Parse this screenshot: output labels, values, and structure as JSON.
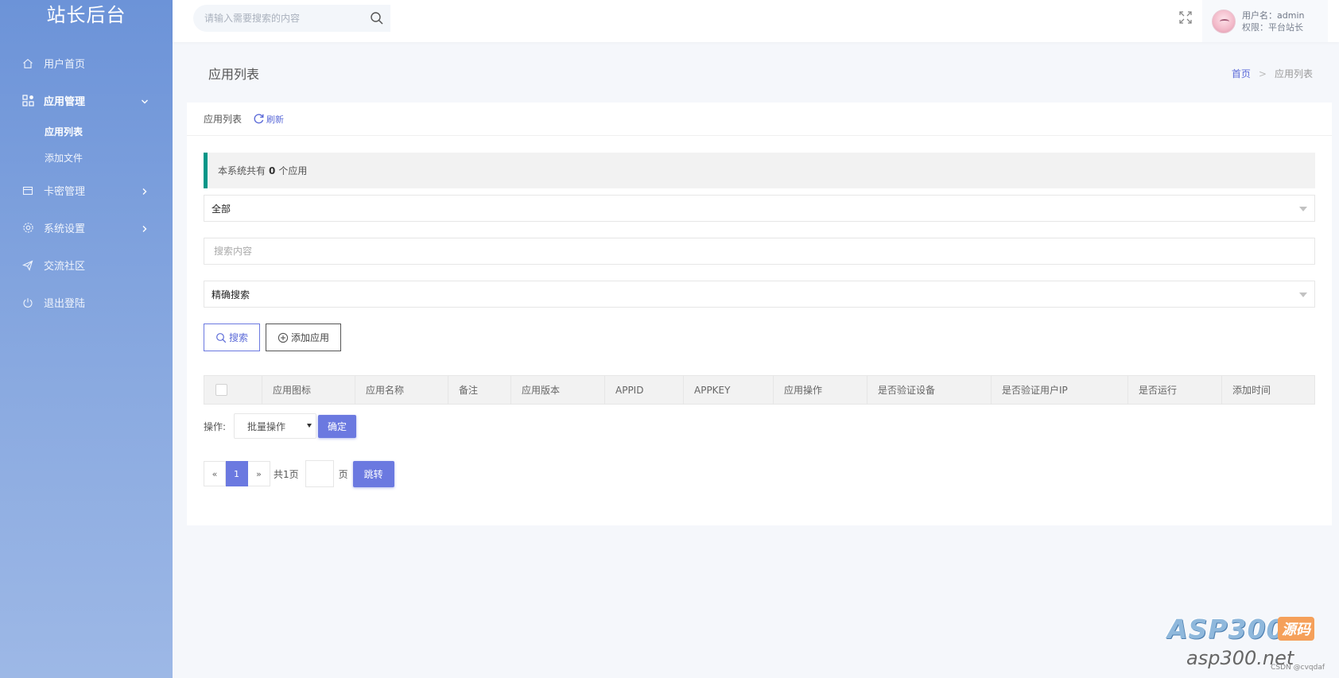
{
  "brand": "站长后台",
  "sidebar": {
    "items": [
      {
        "label": "用户首页"
      },
      {
        "label": "应用管理"
      },
      {
        "label": "卡密管理"
      },
      {
        "label": "系统设置"
      },
      {
        "label": "交流社区"
      },
      {
        "label": "退出登陆"
      }
    ],
    "sub_items": [
      {
        "label": "应用列表"
      },
      {
        "label": "添加文件"
      }
    ]
  },
  "topbar": {
    "search_placeholder": "请输入需要搜索的内容",
    "user_name": "用户名：admin",
    "user_role": "权限：平台站长"
  },
  "page": {
    "title": "应用列表",
    "breadcrumb_home": "首页",
    "breadcrumb_sep": ">",
    "breadcrumb_current": "应用列表"
  },
  "card": {
    "head_title": "应用列表",
    "refresh_label": "刷新",
    "notice_prefix": "本系统共有",
    "notice_count": "0",
    "notice_suffix": "个应用",
    "filter_select": "全部",
    "search_placeholder": "搜索内容",
    "mode_select": "精确搜索",
    "search_button": "搜索",
    "add_button": "添加应用"
  },
  "table": {
    "columns": [
      "应用图标",
      "应用名称",
      "备注",
      "应用版本",
      "APPID",
      "APPKEY",
      "应用操作",
      "是否验证设备",
      "是否验证用户IP",
      "是否运行",
      "添加时间"
    ]
  },
  "batch": {
    "label": "操作:",
    "select": "批量操作",
    "confirm": "确定"
  },
  "pager": {
    "prev": "«",
    "current": "1",
    "next": "»",
    "total": "共1页",
    "unit": "页",
    "jump": "跳转"
  },
  "watermark": {
    "asp": "ASP300",
    "src": "源码",
    "net": "asp300.net",
    "csdn": "CSDN @cvqdaf"
  },
  "colors": {
    "accent": "#6b79e0",
    "notice_border": "#009688",
    "sidebar_top": "#6c93d8"
  }
}
